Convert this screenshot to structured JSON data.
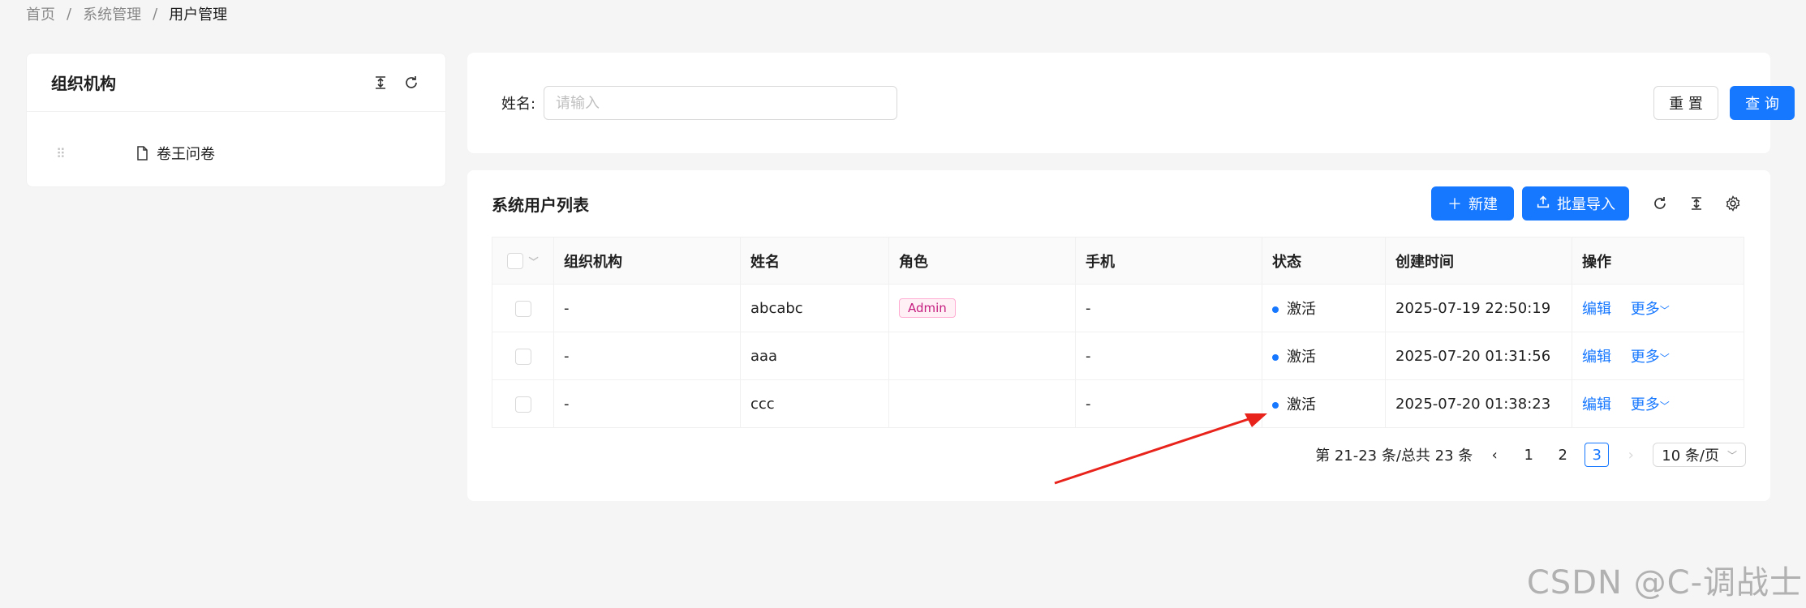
{
  "breadcrumb": {
    "home": "首页",
    "sep": "/",
    "parent": "系统管理",
    "current": "用户管理"
  },
  "org": {
    "title": "组织机构",
    "node": "卷王问卷",
    "icons": [
      "expand-icon",
      "refresh-icon"
    ]
  },
  "search": {
    "label": "姓名:",
    "placeholder": "请输入",
    "value": "",
    "reset": "重 置",
    "query": "查 询"
  },
  "list": {
    "title": "系统用户列表",
    "add": "新建",
    "import": "批量导入",
    "columns": [
      "组织机构",
      "姓名",
      "角色",
      "手机",
      "状态",
      "创建时间",
      "操作"
    ],
    "rows": [
      {
        "org": "-",
        "name": "abcabc",
        "role": "Admin",
        "phone": "-",
        "status": "激活",
        "created": "2025-07-19 22:50:19",
        "edit": "编辑",
        "more": "更多"
      },
      {
        "org": "-",
        "name": "aaa",
        "role": "",
        "phone": "-",
        "status": "激活",
        "created": "2025-07-20 01:31:56",
        "edit": "编辑",
        "more": "更多"
      },
      {
        "org": "-",
        "name": "ccc",
        "role": "",
        "phone": "-",
        "status": "激活",
        "created": "2025-07-20 01:38:23",
        "edit": "编辑",
        "more": "更多"
      }
    ]
  },
  "pagination": {
    "summary": "第 21-23 条/总共 23 条",
    "pages": [
      "1",
      "2",
      "3"
    ],
    "current": "3",
    "size": "10 条/页"
  },
  "colors": {
    "primary": "#1677ff",
    "tag_text": "#c41d7f",
    "tag_bg": "#fff0f6",
    "arrow": "#e8231b"
  },
  "watermark": "CSDN @C-调战士"
}
